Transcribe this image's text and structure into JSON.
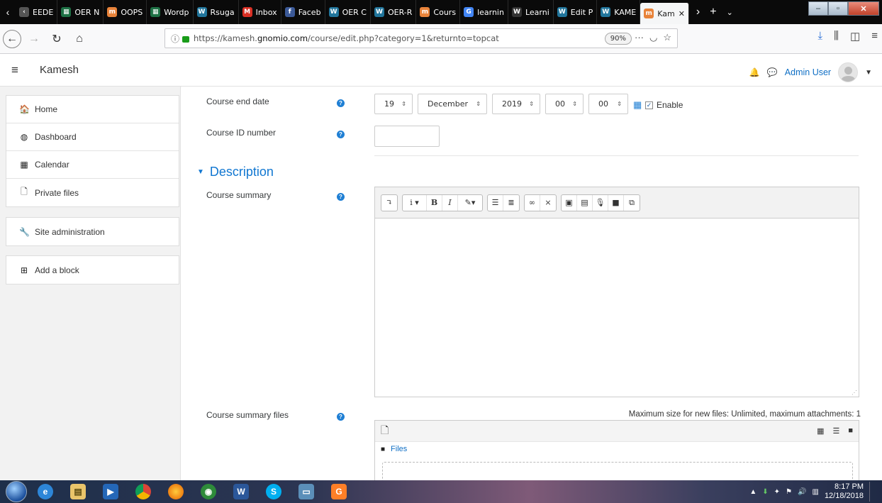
{
  "browser": {
    "tabs": [
      {
        "label": "EEDE",
        "color": "#555555",
        "glyph": "‹"
      },
      {
        "label": "OER N",
        "color": "#1e7145",
        "glyph": "▦"
      },
      {
        "label": "OOPS",
        "color": "#e8833a",
        "glyph": "m"
      },
      {
        "label": "Wordp",
        "color": "#1e7145",
        "glyph": "▦"
      },
      {
        "label": "Rsuga",
        "color": "#21759b",
        "glyph": "W"
      },
      {
        "label": "Inbox",
        "color": "#d93025",
        "glyph": "M"
      },
      {
        "label": "Faceb",
        "color": "#3b5998",
        "glyph": "f"
      },
      {
        "label": "OER C",
        "color": "#21759b",
        "glyph": "W"
      },
      {
        "label": "OER-R",
        "color": "#21759b",
        "glyph": "W"
      },
      {
        "label": "Cours",
        "color": "#e8833a",
        "glyph": "m"
      },
      {
        "label": "learnin",
        "color": "#4285f4",
        "glyph": "G"
      },
      {
        "label": "Learni",
        "color": "#333333",
        "glyph": "W"
      },
      {
        "label": "Edit P",
        "color": "#21759b",
        "glyph": "W"
      },
      {
        "label": "KAME",
        "color": "#21759b",
        "glyph": "W"
      },
      {
        "label": "Kam",
        "color": "#e8833a",
        "glyph": "m",
        "active": true
      }
    ],
    "url_prefix": "https://kamesh.",
    "url_domain": "gnomio.com",
    "url_path": "/course/edit.php?category=1&returnto=topcat",
    "zoom": "90%"
  },
  "header": {
    "site_name": "Kamesh",
    "user_name": "Admin User"
  },
  "sidebar": {
    "group1": [
      {
        "label": "Home",
        "icon": "home-icon",
        "glyph": "🏠"
      },
      {
        "label": "Dashboard",
        "icon": "dashboard-icon",
        "glyph": "◍"
      },
      {
        "label": "Calendar",
        "icon": "calendar-icon",
        "glyph": "▦"
      },
      {
        "label": "Private files",
        "icon": "file-icon",
        "glyph": "🗋"
      }
    ],
    "group2": [
      {
        "label": "Site administration",
        "icon": "wrench-icon",
        "glyph": "🔧"
      }
    ],
    "group3": [
      {
        "label": "Add a block",
        "icon": "plus-square-icon",
        "glyph": "⊞"
      }
    ]
  },
  "form": {
    "end_date_label": "Course end date",
    "end_day": "19",
    "end_month": "December",
    "end_year": "2019",
    "end_hour": "00",
    "end_minute": "00",
    "enable_label": "Enable",
    "enable_checked": true,
    "id_number_label": "Course ID number",
    "description_heading": "Description",
    "summary_label": "Course summary",
    "summary_files_label": "Course summary files",
    "files_note": "Maximum size for new files: Unlimited, maximum attachments: 1",
    "files_folder": "Files"
  },
  "taskbar": {
    "time": "8:17 PM",
    "date": "12/18/2018"
  }
}
